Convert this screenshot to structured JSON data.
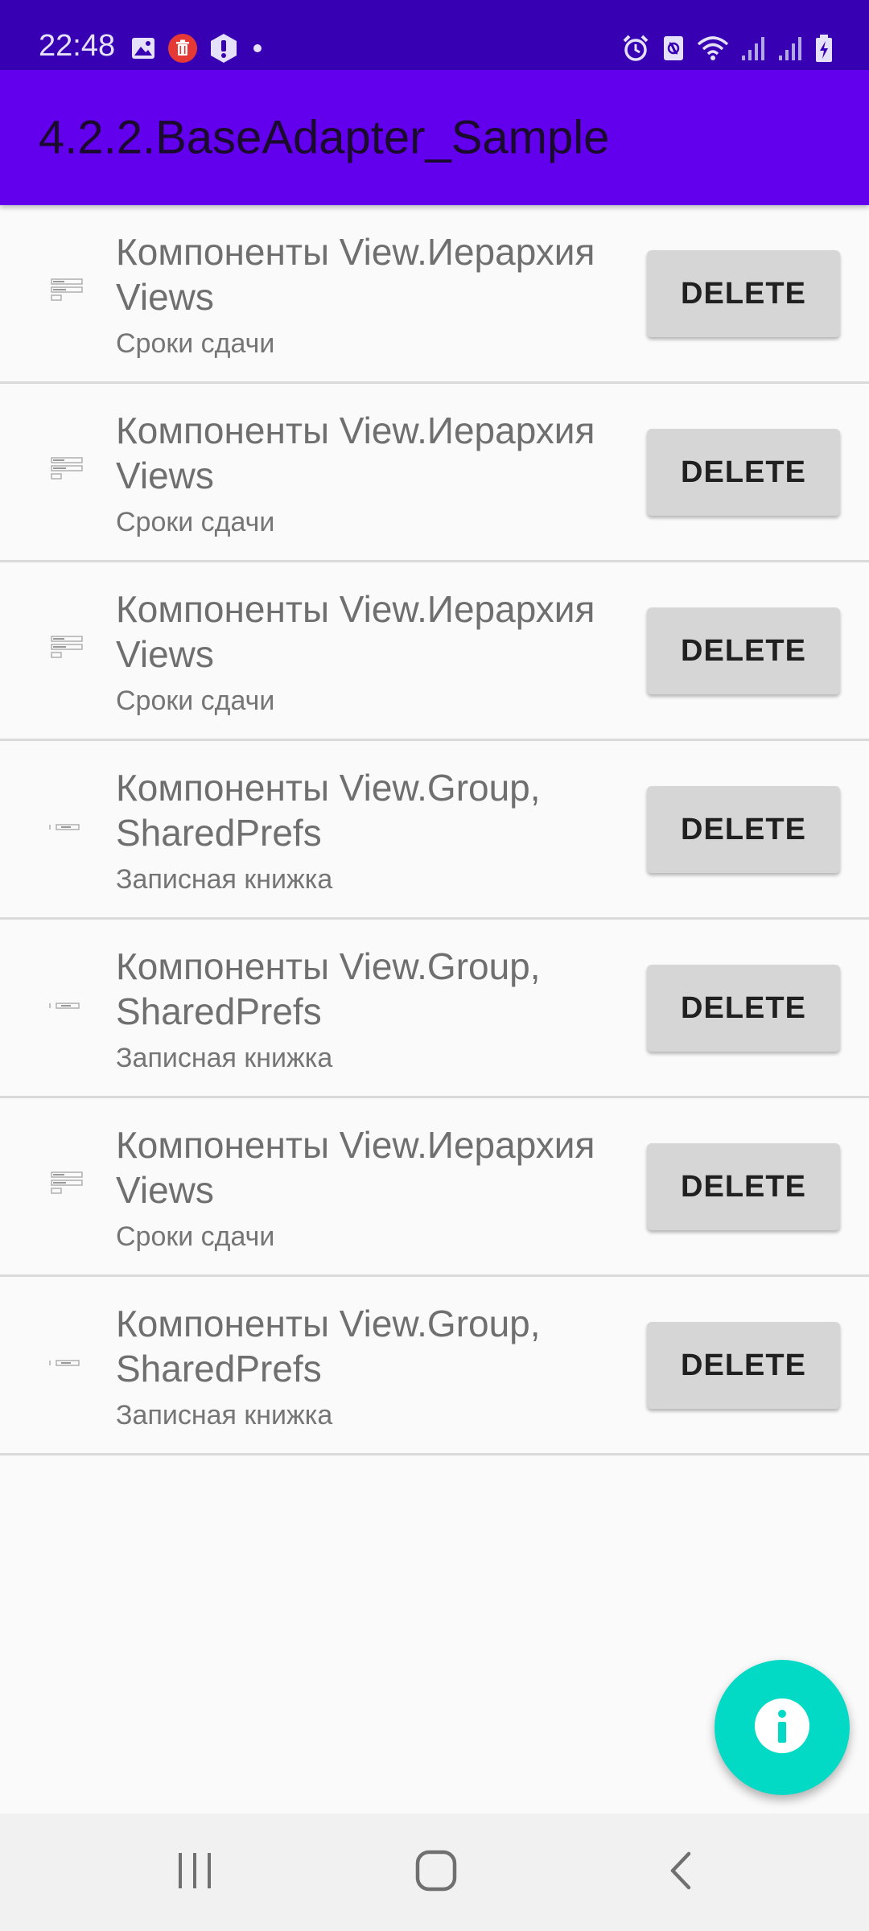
{
  "status_bar": {
    "time": "22:48",
    "left_icons": [
      "image-icon",
      "delete-notification-icon",
      "app-notification-icon",
      "dot-icon"
    ],
    "right_icons": [
      "alarm-icon",
      "nfc-icon",
      "wifi-icon",
      "signal-icon",
      "signal-icon-2",
      "battery-charging-icon"
    ]
  },
  "app_bar": {
    "title": "4.2.2.BaseAdapter_Sample",
    "background_color": "#6200ee"
  },
  "list": {
    "items": [
      {
        "title": "Компоненты View.Иерархия Views",
        "subtitle": "Сроки сдачи",
        "button_label": "DELETE",
        "thumb": "form-thumbnail"
      },
      {
        "title": "Компоненты View.Иерархия Views",
        "subtitle": "Сроки сдачи",
        "button_label": "DELETE",
        "thumb": "form-thumbnail"
      },
      {
        "title": "Компоненты View.Иерархия Views",
        "subtitle": "Сроки сдачи",
        "button_label": "DELETE",
        "thumb": "form-thumbnail"
      },
      {
        "title": "Компоненты View.Group, SharedPrefs",
        "subtitle": "Записная книжка",
        "button_label": "DELETE",
        "thumb": "field-thumbnail"
      },
      {
        "title": "Компоненты View.Group, SharedPrefs",
        "subtitle": "Записная книжка",
        "button_label": "DELETE",
        "thumb": "field-thumbnail"
      },
      {
        "title": "Компоненты View.Иерархия Views",
        "subtitle": "Сроки сдачи",
        "button_label": "DELETE",
        "thumb": "form-thumbnail"
      },
      {
        "title": "Компоненты View.Group, SharedPrefs",
        "subtitle": "Записная книжка",
        "button_label": "DELETE",
        "thumb": "field-thumbnail"
      }
    ]
  },
  "fab": {
    "icon": "info-icon",
    "color": "#03dac5"
  },
  "nav_bar": {
    "buttons": [
      "recent-apps-icon",
      "home-icon",
      "back-icon"
    ]
  }
}
